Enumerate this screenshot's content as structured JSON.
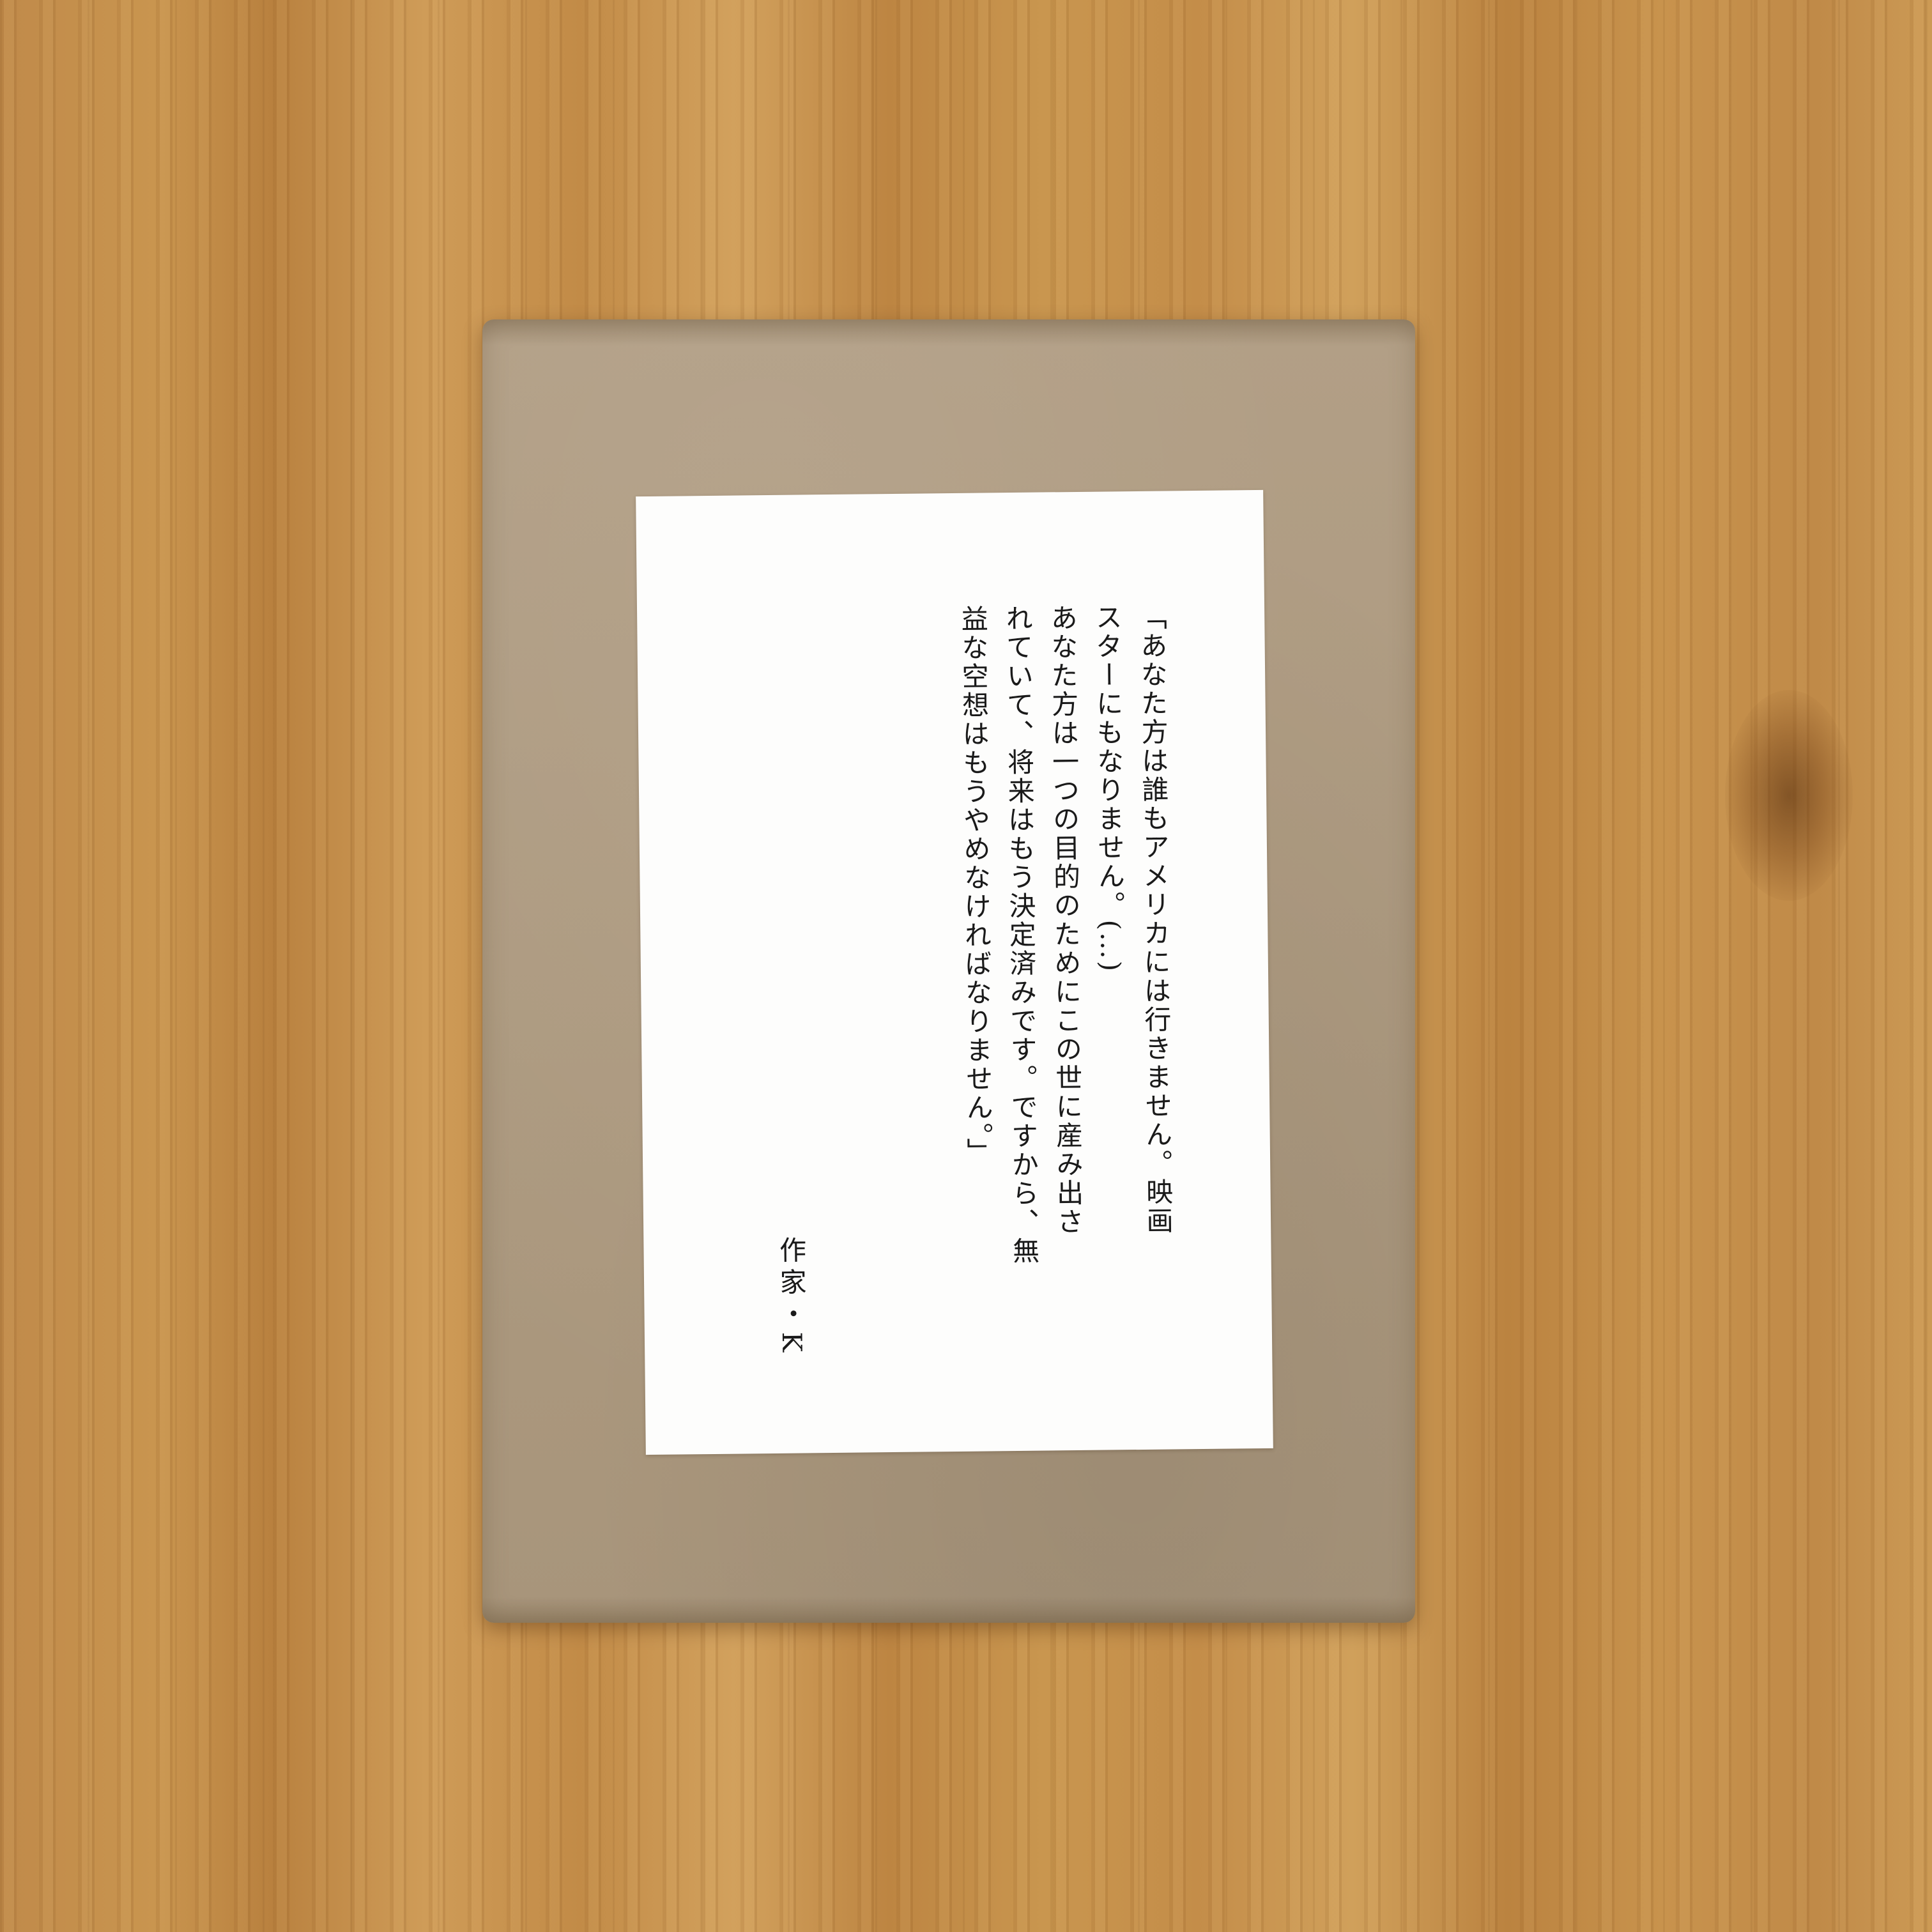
{
  "card": {
    "lines": [
      "「あなた方は誰もアメリカには行きません。映画",
      "スターにもなりません。(…)",
      "あなた方は一つの目的のためにこの世に産み出さ",
      "れていて、将来はもう決定済みです。ですから、無",
      "益な空想はもうやめなければなりません。」"
    ],
    "author": "作家・K"
  },
  "colors": {
    "wood": "#c48d49",
    "kraft_paper": "#ad9a80",
    "card": "#fdfdfc",
    "ink": "#1a1a1a"
  }
}
